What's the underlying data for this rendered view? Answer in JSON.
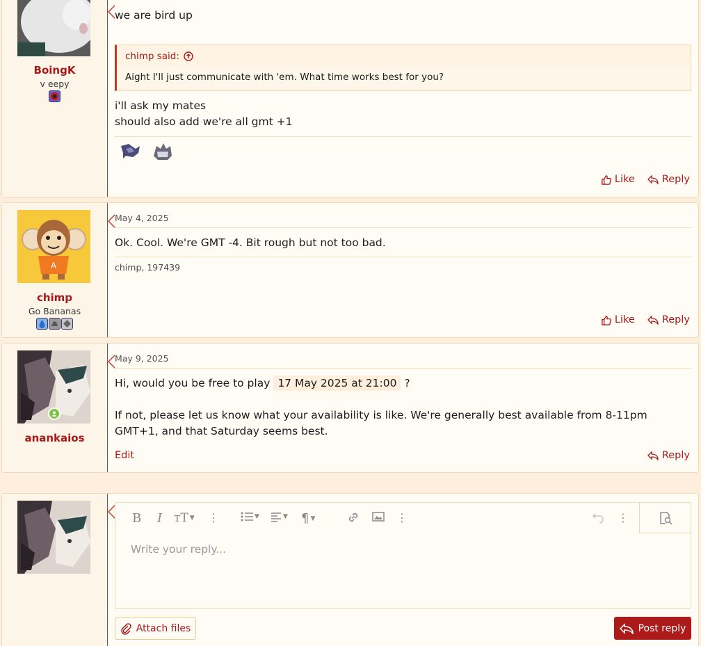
{
  "posts": [
    {
      "username": "BoingK",
      "user_title": "v eepy",
      "text_top": "we are bird up",
      "quote": {
        "author_label": "chimp said:",
        "body": "Aight I'll just communicate with 'em. What time works best for you?"
      },
      "text_lines": [
        "i'll ask my mates",
        "should also add we're all gmt +1"
      ],
      "like_label": "Like",
      "reply_label": "Reply"
    },
    {
      "username": "chimp",
      "user_title": "Go Bananas",
      "date": "May 4, 2025",
      "text": "Ok. Cool. We're GMT -4. Bit rough but not too bad.",
      "reactions_name": "chimp",
      "reactions_extra": ", 197439",
      "like_label": "Like",
      "reply_label": "Reply"
    },
    {
      "username": "anankaios",
      "date": "May 9, 2025",
      "text_before": "Hi, would you be free to play",
      "time_chip": "17 May 2025 at 21:00",
      "text_after": "?",
      "paragraph": "If not, please let us know what your availability is like. We're generally best available from 8-11pm GMT+1, and that Saturday seems best.",
      "edit_label": "Edit",
      "reply_label": "Reply"
    }
  ],
  "editor": {
    "placeholder": "Write your reply...",
    "attach_label": "Attach files",
    "post_label": "Post reply"
  },
  "colors": {
    "accent": "#a81a1a",
    "background": "#fdeedd",
    "post_bg": "#fffcf6"
  }
}
